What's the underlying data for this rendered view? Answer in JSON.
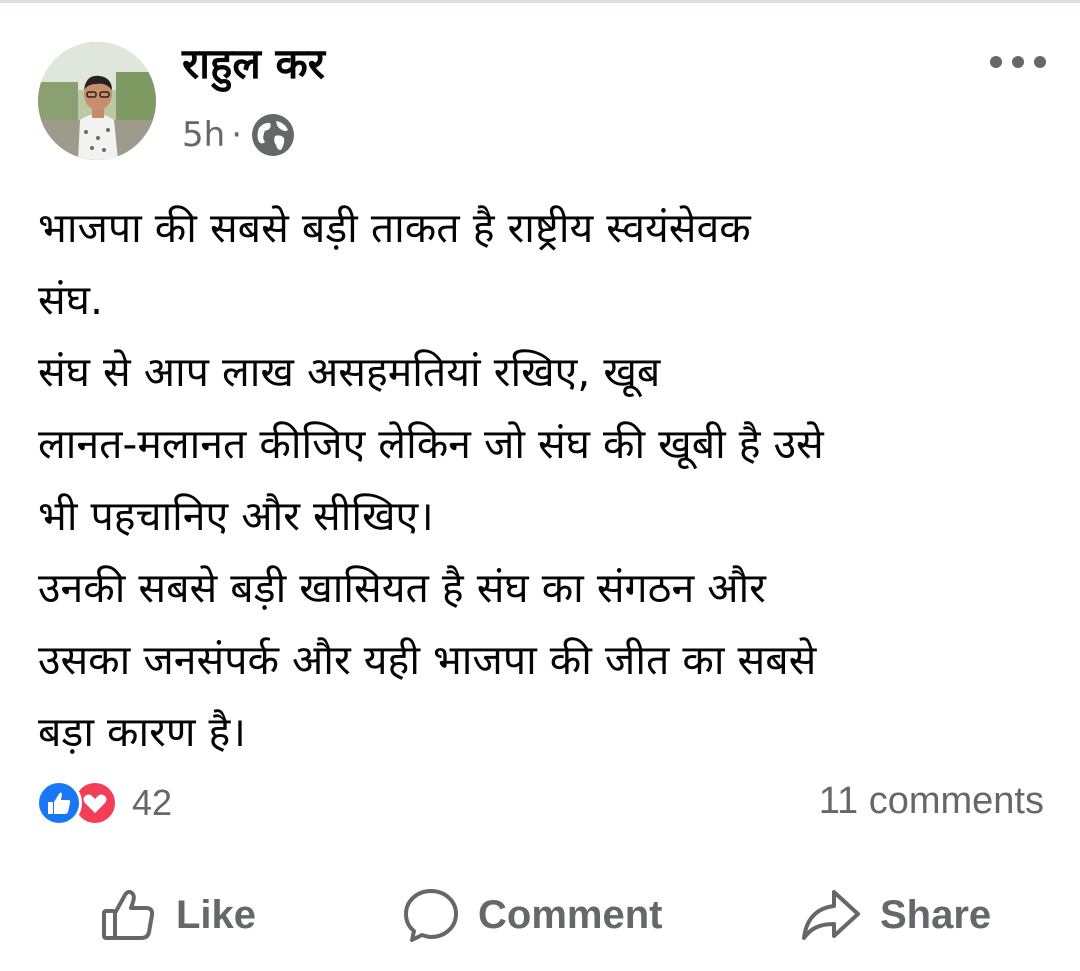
{
  "post": {
    "author": "राहुल कर",
    "time": "5h",
    "separator": "·",
    "privacy_icon": "globe-icon",
    "menu_icon": "more-horizontal-icon",
    "lines": [
      "भाजपा की सबसे बड़ी ताकत है राष्ट्रीय स्वयंसेवक",
      "संघ.",
      "संघ से आप लाख असहमतियां रखिए, खूब",
      "लानत-मलानत कीजिए लेकिन जो संघ की खूबी है उसे",
      "भी पहचानिए और सीखिए।",
      "उनकी सबसे बड़ी खासियत है संघ का संगठन और",
      "उसका जनसंपर्क और यही भाजपा की जीत का सबसे",
      "बड़ा कारण है।"
    ]
  },
  "reactions": {
    "icons": [
      "like-reaction-icon",
      "love-reaction-icon"
    ],
    "count": "42",
    "comments": "11 comments"
  },
  "actions": {
    "like": "Like",
    "comment": "Comment",
    "share": "Share"
  },
  "colors": {
    "text": "#050505",
    "secondary": "#65676b",
    "like_blue": "#1877f2",
    "love_red": "#f33e58"
  }
}
